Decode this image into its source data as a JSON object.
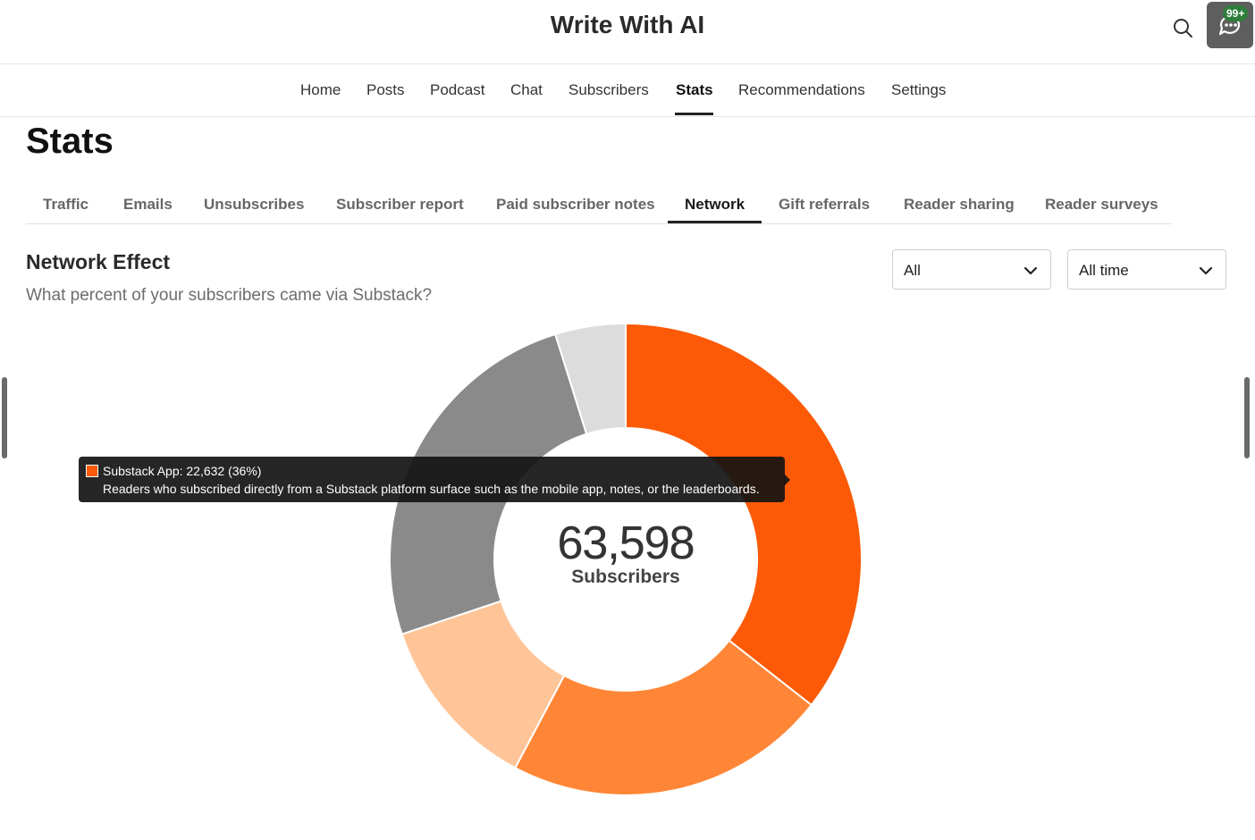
{
  "header": {
    "site_title": "Write With AI",
    "chat_badge": "99+"
  },
  "nav": {
    "items": [
      {
        "label": "Home"
      },
      {
        "label": "Posts"
      },
      {
        "label": "Podcast"
      },
      {
        "label": "Chat"
      },
      {
        "label": "Subscribers"
      },
      {
        "label": "Stats"
      },
      {
        "label": "Recommendations"
      },
      {
        "label": "Settings"
      }
    ],
    "active": "Stats"
  },
  "page": {
    "title": "Stats"
  },
  "subtabs": {
    "items": [
      {
        "label": "Traffic"
      },
      {
        "label": "Emails"
      },
      {
        "label": "Unsubscribes"
      },
      {
        "label": "Subscriber report"
      },
      {
        "label": "Paid subscriber notes"
      },
      {
        "label": "Network"
      },
      {
        "label": "Gift referrals"
      },
      {
        "label": "Reader sharing"
      },
      {
        "label": "Reader surveys"
      }
    ],
    "active": "Network"
  },
  "section": {
    "title": "Network Effect",
    "subtitle": "What percent of your subscribers came via Substack?"
  },
  "filters": {
    "audience": "All",
    "period": "All time"
  },
  "tooltip": {
    "line1": "Substack App: 22,632 (36%)",
    "line2": "Readers who subscribed directly from a Substack platform surface such as the mobile app, notes, or the leaderboards."
  },
  "chart_data": {
    "type": "pie",
    "variant": "donut",
    "total_label": "63,598",
    "total_caption": "Subscribers",
    "total": 63598,
    "segments": [
      {
        "name": "Substack App",
        "value": 22632,
        "percent": 36,
        "color": "#fc5a06"
      },
      {
        "value": 14100,
        "color": "#ff8636"
      },
      {
        "value": 7700,
        "color": "#ffc598"
      },
      {
        "value": 16100,
        "color": "#8a8a8a"
      },
      {
        "value": 3066,
        "color": "#dcdcdc"
      }
    ]
  }
}
